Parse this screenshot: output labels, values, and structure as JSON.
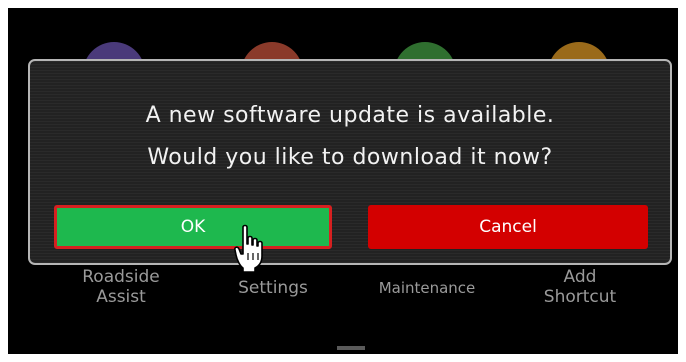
{
  "apps": [
    {
      "label_line1": "Roadside",
      "label_line2": "Assist",
      "icon": "roadside-assist-icon",
      "color": "#4a3a7a"
    },
    {
      "label_line1": "Settings",
      "label_line2": "",
      "icon": "settings-icon",
      "color": "#8a3a2a"
    },
    {
      "label_line1": "Maintenance",
      "label_line2": "",
      "icon": "maintenance-icon",
      "color": "#2f6f2f"
    },
    {
      "label_line1": "Add",
      "label_line2": "Shortcut",
      "icon": "add-shortcut-icon",
      "color": "#9a6a1a"
    }
  ],
  "dialog": {
    "line1": "A new software update is available.",
    "line2": "Would you like to download it now?",
    "ok_label": "OK",
    "cancel_label": "Cancel"
  },
  "colors": {
    "ok": "#1eb84e",
    "ok_border": "#d62020",
    "cancel": "#d30000",
    "dialog_border": "#b5b5b5"
  },
  "cursor_icon": "hand-pointer-icon",
  "handle_icon": "drag-handle-icon"
}
